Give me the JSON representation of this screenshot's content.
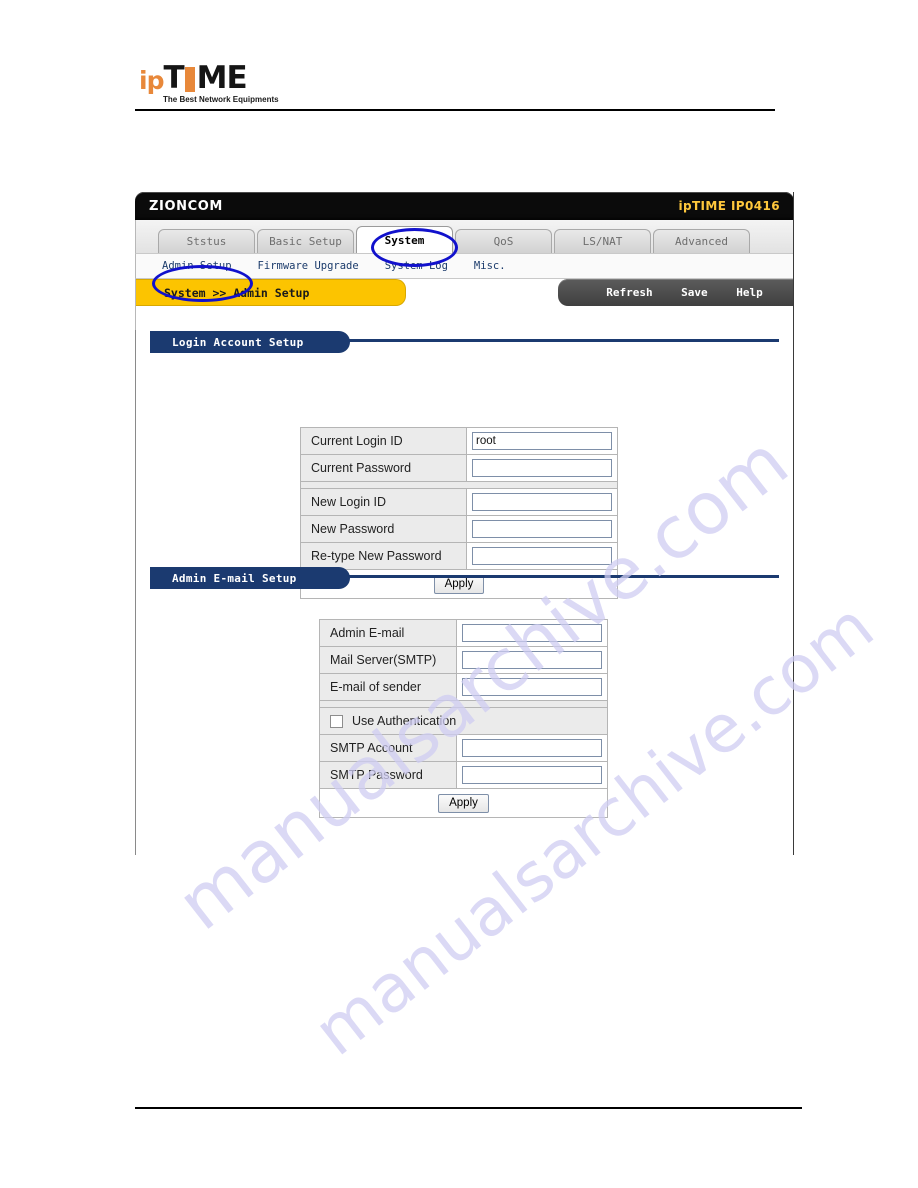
{
  "document": {
    "logo": {
      "prefix": "ip",
      "word_t": "T",
      "word_me": "ME",
      "tagline": "The Best Network Equipments"
    },
    "watermark_line1": "manualsarchive.com",
    "watermark_line2": "manualsarchive.com"
  },
  "router_ui": {
    "header": {
      "vendor": "ZIONCOM",
      "model": "ipTIME IP0416"
    },
    "tabs": [
      {
        "label": "Ststus",
        "active": false
      },
      {
        "label": "Basic Setup",
        "active": false
      },
      {
        "label": "System",
        "active": true
      },
      {
        "label": "QoS",
        "active": false
      },
      {
        "label": "LS/NAT",
        "active": false
      },
      {
        "label": "Advanced",
        "active": false
      }
    ],
    "subnav": [
      {
        "label": "Admin Setup",
        "active": true
      },
      {
        "label": "Firmware Upgrade",
        "active": false
      },
      {
        "label": "System Log",
        "active": false
      },
      {
        "label": "Misc.",
        "active": false
      }
    ],
    "breadcrumb": "System >> Admin Setup",
    "toolbar": {
      "refresh": "Refresh",
      "save": "Save",
      "help": "Help"
    },
    "sections": [
      {
        "title": "Login Account Setup",
        "rows": [
          {
            "label": "Current Login ID",
            "value": "root",
            "placeholder": ""
          },
          {
            "label": "Current Password",
            "value": "",
            "placeholder": ""
          },
          {
            "label": "New Login ID",
            "value": "",
            "placeholder": ""
          },
          {
            "label": "New Password",
            "value": "",
            "placeholder": ""
          },
          {
            "label": "Re-type New Password",
            "value": "",
            "placeholder": ""
          }
        ],
        "apply_label": "Apply"
      },
      {
        "title": "Admin E-mail Setup",
        "rows": [
          {
            "label": "Admin E-mail",
            "value": "",
            "placeholder": ""
          },
          {
            "label": "Mail Server(SMTP)",
            "value": "",
            "placeholder": ""
          },
          {
            "label": "E-mail of sender",
            "value": "",
            "placeholder": ""
          },
          {
            "label": "SMTP Account",
            "value": "",
            "placeholder": ""
          },
          {
            "label": "SMTP Password",
            "value": "",
            "placeholder": ""
          }
        ],
        "checkbox_label": "Use Authentication",
        "checkbox_checked": false,
        "apply_label": "Apply"
      }
    ],
    "colors": {
      "header_bg": "#0b0b0b",
      "model_text": "#ffc83c",
      "breadcrumb_bg": "#fcc400",
      "section_pill": "#1b3a70",
      "toolbar_bg": "#4b4b4b",
      "annotation": "#1111cc"
    }
  }
}
